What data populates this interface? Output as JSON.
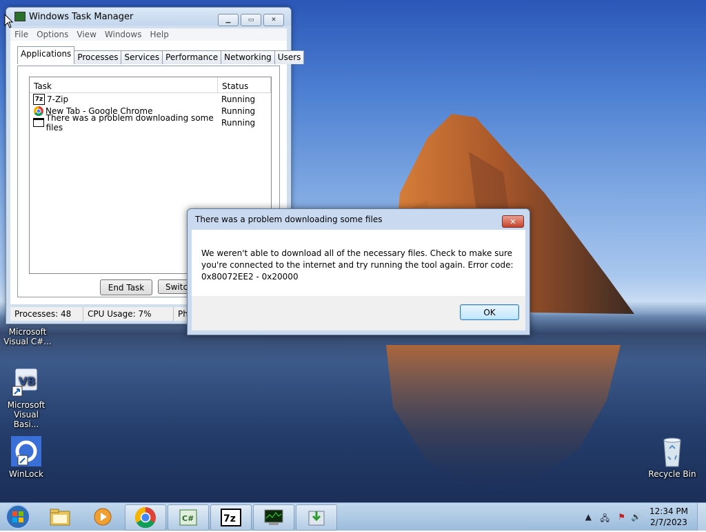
{
  "colors": {
    "accent": "#3c7fb1",
    "titlebar": "#c9daf0",
    "close_red": "#c8442c"
  },
  "desktop_icons": [
    {
      "label": "Microsoft Visual C#...",
      "icon": "visual-csharp-icon"
    },
    {
      "label": "Microsoft Visual Basi...",
      "icon": "visual-basic-icon"
    },
    {
      "label": "WinLock",
      "icon": "winlock-icon"
    },
    {
      "label": "Recycle Bin",
      "icon": "recycle-bin-icon"
    }
  ],
  "task_manager": {
    "title": "Windows Task Manager",
    "menu": [
      "File",
      "Options",
      "View",
      "Windows",
      "Help"
    ],
    "tabs": [
      "Applications",
      "Processes",
      "Services",
      "Performance",
      "Networking",
      "Users"
    ],
    "active_tab": "Applications",
    "columns": {
      "task": "Task",
      "status": "Status"
    },
    "rows": [
      {
        "task": "7-Zip",
        "status": "Running",
        "icon": "7zip-icon"
      },
      {
        "task": "New Tab - Google Chrome",
        "status": "Running",
        "icon": "chrome-icon"
      },
      {
        "task": "There was a problem downloading some files",
        "status": "Running",
        "icon": "window-icon"
      }
    ],
    "buttons": {
      "end_task": "End Task",
      "switch_to": "Switch"
    },
    "status": {
      "processes": "Processes: 48",
      "cpu": "CPU Usage: 7%",
      "memory": "Ph"
    }
  },
  "dialog": {
    "title": "There was a problem downloading some files",
    "message": "We weren't able to download all of the necessary files. Check to make sure you're connected to the internet and try running the tool again. Error code: 0x80072EE2 - 0x20000",
    "ok_label": "OK",
    "close_glyph": "✕"
  },
  "taskbar": {
    "start_icon": "windows-start-icon",
    "items": [
      "explorer-icon",
      "media-player-icon",
      "chrome-icon",
      "csharp-project-icon",
      "7zip-icon",
      "task-manager-icon",
      "installer-icon"
    ],
    "time": "12:34 PM",
    "date": "2/7/2023"
  }
}
